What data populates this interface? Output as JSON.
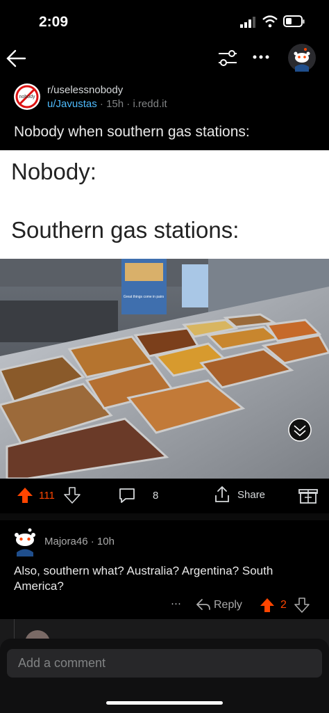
{
  "status_bar": {
    "time": "2:09"
  },
  "post": {
    "subreddit": "r/uselessnobody",
    "subreddit_avatar_text": "nobody",
    "author": "u/Javustas",
    "age": "15h",
    "domain": "i.redd.it",
    "meta_sep": "·",
    "title": "Nobody when southern gas stations:",
    "meme_line1": "Nobody:",
    "meme_line2": "Southern gas stations:",
    "photo_sign": "Great things come in pairs",
    "upvotes": "111",
    "comments": "8",
    "share_label": "Share"
  },
  "comment": {
    "author": "Majora46",
    "age": "10h",
    "meta_sep": "·",
    "body": "Also, southern what? Australia? Argentina? South America?",
    "more": "···",
    "reply_label": "Reply",
    "score": "2"
  },
  "composer": {
    "placeholder": "Add a comment"
  },
  "colors": {
    "accent": "#ff4500",
    "link": "#4fbcff",
    "background": "#000000"
  }
}
